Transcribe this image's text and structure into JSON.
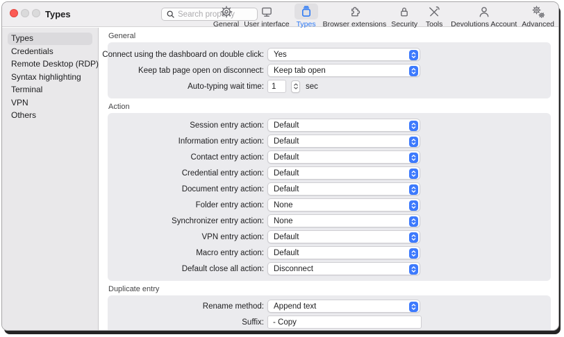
{
  "colors": {
    "accent": "#3d7afd",
    "selected_text": "#2e7bf6",
    "close_button": "#fc5b54"
  },
  "titlebar": {
    "title": "Types",
    "search_placeholder": "Search property"
  },
  "toolbar": {
    "items": [
      {
        "label": "General",
        "icon": "gear-icon",
        "selected": false
      },
      {
        "label": "User interface",
        "icon": "display-icon",
        "selected": false
      },
      {
        "label": "Types",
        "icon": "container-icon",
        "selected": true
      },
      {
        "label": "Browser extensions",
        "icon": "puzzle-icon",
        "selected": false
      },
      {
        "label": "Security",
        "icon": "lock-icon",
        "selected": false
      },
      {
        "label": "Tools",
        "icon": "tools-icon",
        "selected": false
      },
      {
        "label": "Devolutions Account",
        "icon": "person-icon",
        "selected": false
      },
      {
        "label": "Advanced",
        "icon": "gears-icon",
        "selected": false
      }
    ]
  },
  "sidebar": {
    "items": [
      {
        "label": "Types",
        "selected": true
      },
      {
        "label": "Credentials",
        "selected": false
      },
      {
        "label": "Remote Desktop (RDP)",
        "selected": false
      },
      {
        "label": "Syntax highlighting",
        "selected": false
      },
      {
        "label": "Terminal",
        "selected": false
      },
      {
        "label": "VPN",
        "selected": false
      },
      {
        "label": "Others",
        "selected": false
      }
    ]
  },
  "sections": [
    {
      "title": "General",
      "rows": [
        {
          "label": "Connect using the dashboard on double click:",
          "type": "select",
          "value": "Yes"
        },
        {
          "label": "Keep tab page open on disconnect:",
          "type": "select",
          "value": "Keep tab open"
        },
        {
          "label": "Auto-typing wait time:",
          "type": "stepper",
          "value": "1",
          "suffix": "sec"
        }
      ]
    },
    {
      "title": "Action",
      "rows": [
        {
          "label": "Session entry action:",
          "type": "select",
          "value": "Default"
        },
        {
          "label": "Information entry action:",
          "type": "select",
          "value": "Default"
        },
        {
          "label": "Contact entry action:",
          "type": "select",
          "value": "Default"
        },
        {
          "label": "Credential entry action:",
          "type": "select",
          "value": "Default"
        },
        {
          "label": "Document entry action:",
          "type": "select",
          "value": "Default"
        },
        {
          "label": "Folder entry action:",
          "type": "select",
          "value": "None"
        },
        {
          "label": "Synchronizer entry action:",
          "type": "select",
          "value": "None"
        },
        {
          "label": "VPN entry action:",
          "type": "select",
          "value": "Default"
        },
        {
          "label": "Macro entry action:",
          "type": "select",
          "value": "Default"
        },
        {
          "label": "Default close all action:",
          "type": "select",
          "value": "Disconnect"
        }
      ]
    },
    {
      "title": "Duplicate entry",
      "rows": [
        {
          "label": "Rename method:",
          "type": "select",
          "value": "Append text"
        },
        {
          "label": "Suffix:",
          "type": "text",
          "value": "- Copy"
        }
      ]
    }
  ]
}
